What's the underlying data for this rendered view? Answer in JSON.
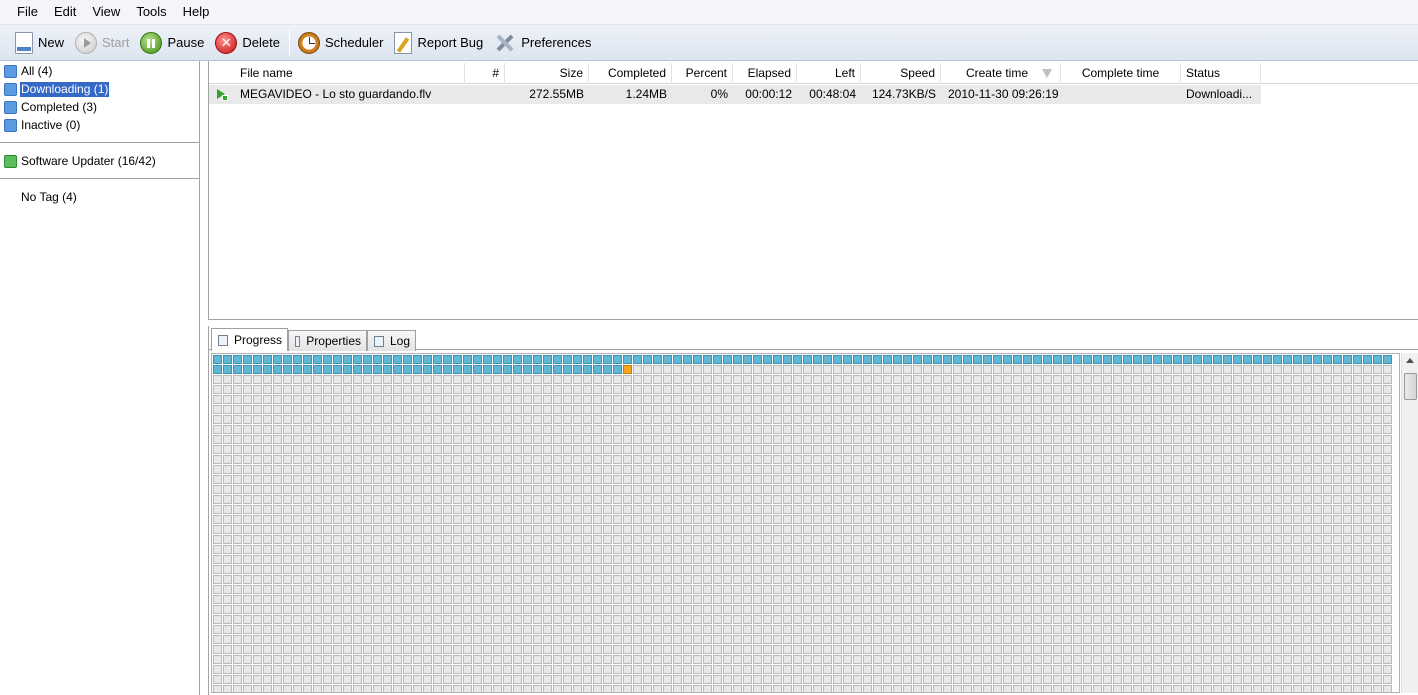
{
  "menu": [
    "File",
    "Edit",
    "View",
    "Tools",
    "Help"
  ],
  "toolbar": {
    "new_label": "New",
    "start_label": "Start",
    "pause_label": "Pause",
    "delete_label": "Delete",
    "scheduler_label": "Scheduler",
    "report_bug_label": "Report Bug",
    "preferences_label": "Preferences"
  },
  "sidebar": {
    "categories": [
      {
        "label": "All (4)",
        "icon": "list-icon"
      },
      {
        "label": "Downloading (1)",
        "icon": "download-icon",
        "selected": true
      },
      {
        "label": "Completed (3)",
        "icon": "completed-icon"
      },
      {
        "label": "Inactive (0)",
        "icon": "inactive-icon"
      }
    ],
    "updater_label": "Software Updater (16/42)",
    "tag_label": "No Tag (4)"
  },
  "filelist": {
    "columns": [
      "File name",
      "#",
      "Size",
      "Completed",
      "Percent",
      "Elapsed",
      "Left",
      "Speed",
      "Create time",
      "Complete time",
      "Status"
    ],
    "rows": [
      {
        "name": "MEGAVIDEO - Lo sto guardando.flv",
        "num": "",
        "size": "272.55MB",
        "completed": "1.24MB",
        "percent": "0%",
        "elapsed": "00:00:12",
        "left": "00:48:04",
        "speed": "124.73KB/S",
        "create_time": "2010-11-30 09:26:19",
        "complete_time": "",
        "status": "Downloadi..."
      }
    ]
  },
  "detail_tabs": [
    "Progress",
    "Properties",
    "Log"
  ],
  "progress_grid": {
    "blocks_per_row": 118,
    "completed_blocks": 159,
    "active_blocks": 1,
    "colors": {
      "completed": "#5fb8d6",
      "active": "#f5a623",
      "pending": "#e8e8e6"
    }
  }
}
